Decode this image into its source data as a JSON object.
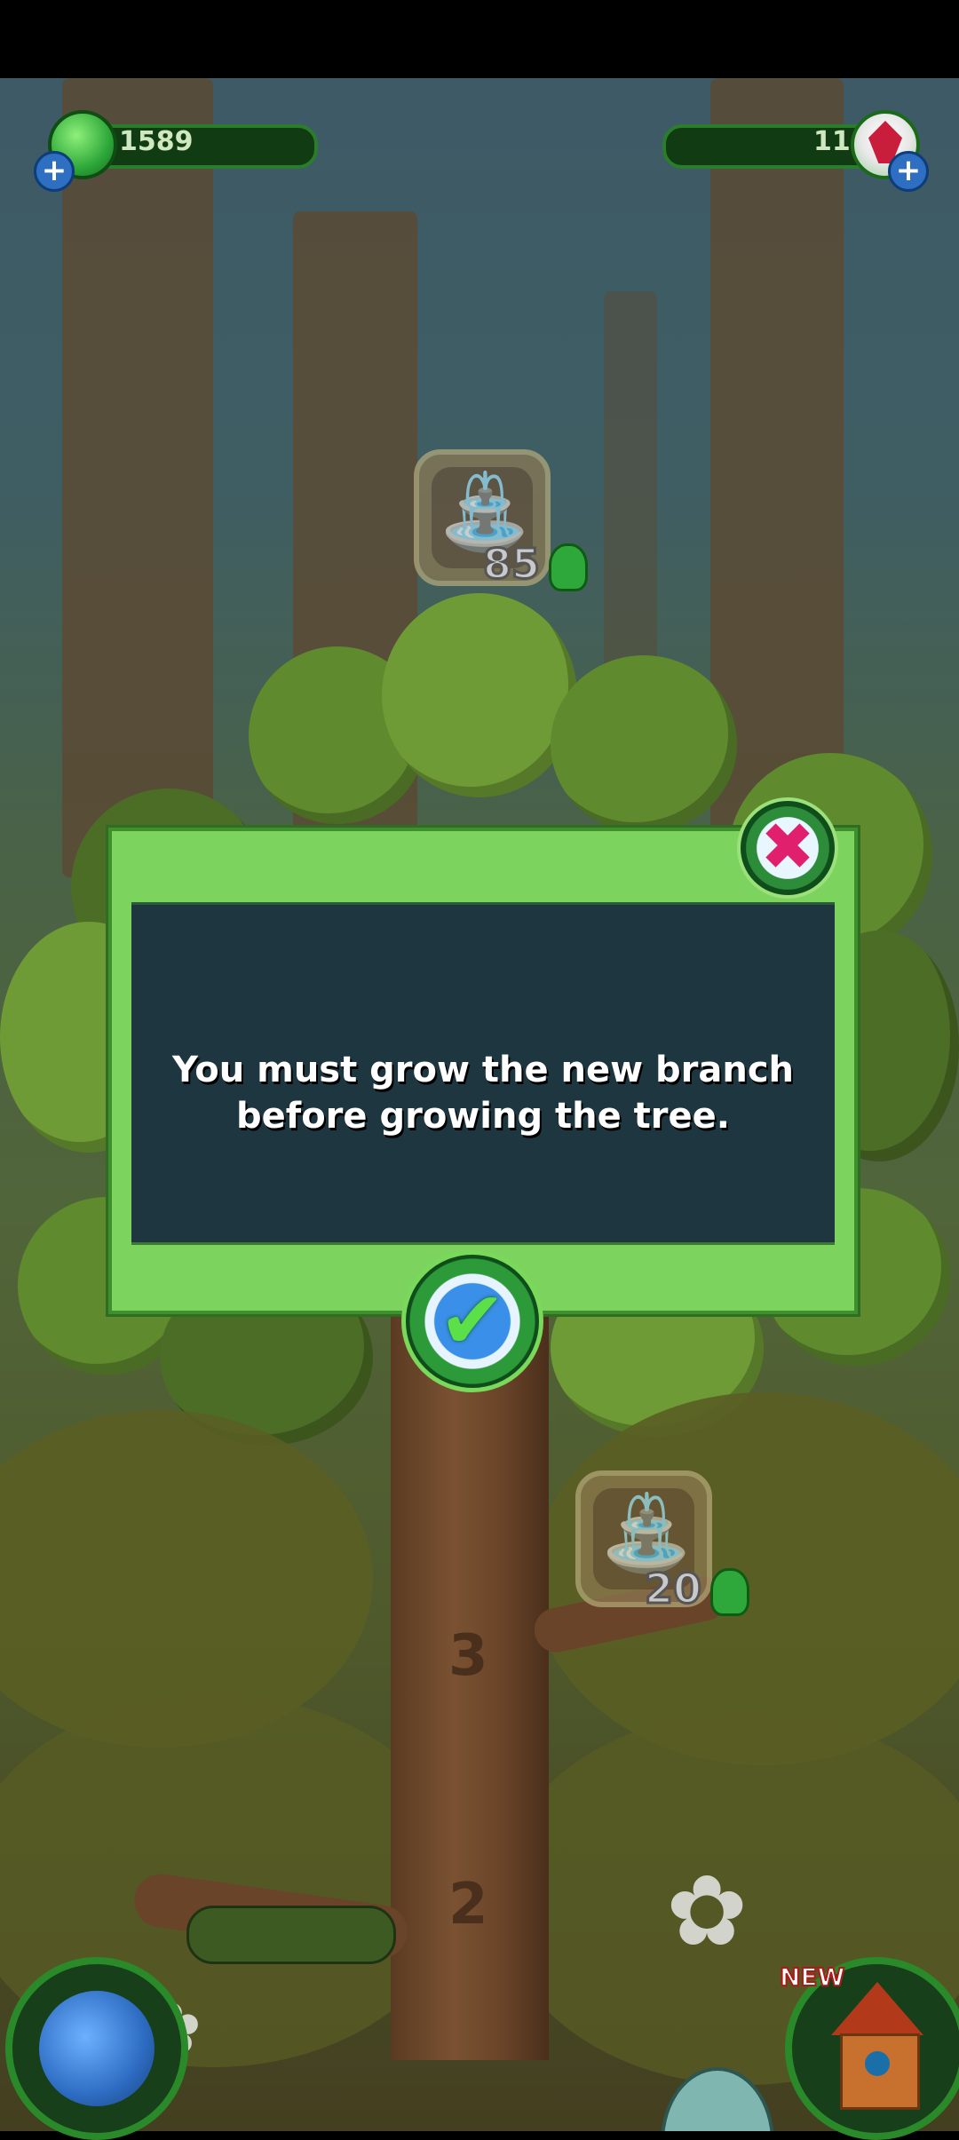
{
  "hud": {
    "left_currency_value": "1589",
    "right_currency_value": "11",
    "plus_label": "+"
  },
  "upgrades": [
    {
      "icon": "watering-can-icon",
      "cost": "85"
    },
    {
      "icon": "watering-can-icon",
      "cost": "20"
    }
  ],
  "tree": {
    "level_marks": [
      "3",
      "2"
    ]
  },
  "dialog": {
    "message_line1": "You must grow the new branch",
    "message_line2": "before growing the tree.",
    "close_glyph": "✖",
    "confirm_glyph": "✔"
  },
  "bottom": {
    "new_badge": "NEW"
  },
  "colors": {
    "dialog_frame": "#7cd45e",
    "dialog_panel": "#1e363f",
    "close_accent": "#e0206c",
    "confirm_accent": "#3a8fe8"
  }
}
